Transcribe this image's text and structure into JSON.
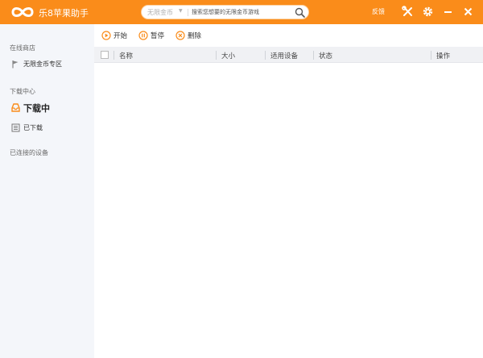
{
  "app": {
    "title": "乐8苹果助手",
    "feedback_label": "反馈"
  },
  "search": {
    "category": "无限金币",
    "placeholder": "搜索您想要的无限金币游戏"
  },
  "sidebar": {
    "online_store": {
      "title": "在线商店",
      "items": [
        {
          "label": "无限金币专区",
          "icon": "flag-icon"
        }
      ]
    },
    "download_center": {
      "title": "下载中心",
      "items": [
        {
          "label": "下载中",
          "icon": "download-tray-icon",
          "active": true
        },
        {
          "label": "已下载",
          "icon": "list-icon",
          "active": false
        }
      ]
    },
    "devices": {
      "title": "已连接的设备"
    }
  },
  "toolbar": {
    "start_label": "开始",
    "pause_label": "暂停",
    "delete_label": "删除"
  },
  "table": {
    "columns": [
      "名称",
      "大小",
      "适用设备",
      "状态",
      "操作"
    ],
    "rows": []
  },
  "colors": {
    "accent": "#fa8c1a",
    "sidebar_bg": "#f4f6fa",
    "header_bg": "#f0f1f4"
  }
}
